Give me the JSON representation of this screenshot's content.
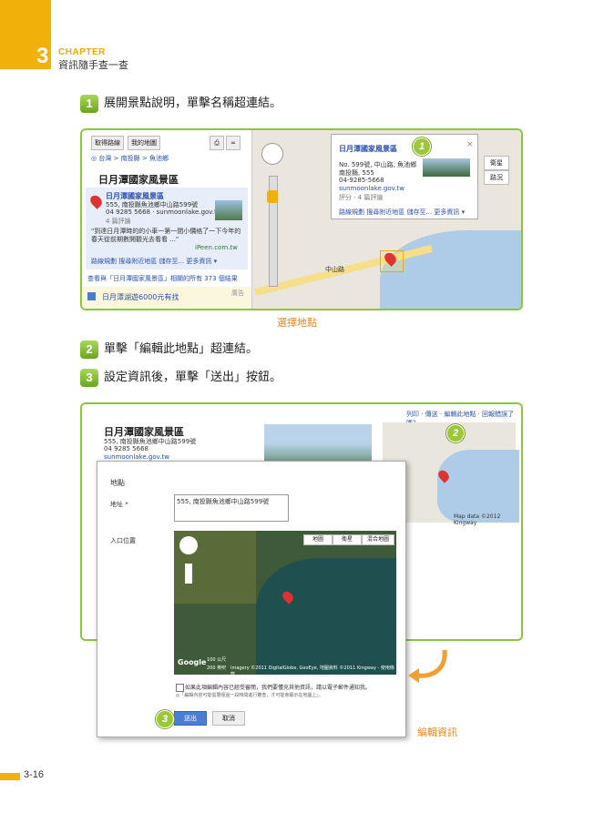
{
  "header": {
    "chapter_label": "CHAPTER",
    "chapter_number": "3",
    "chapter_title": "資訊隨手查一查"
  },
  "steps": [
    {
      "num": "1",
      "text": "展開景點說明，單擊名稱超連結。"
    },
    {
      "num": "2",
      "text": "單擊「編輯此地點」超連結。"
    },
    {
      "num": "3",
      "text": "設定資訊後，單擊「送出」按鈕。"
    }
  ],
  "shot1": {
    "top_buttons": [
      "取得路線",
      "我的地圖"
    ],
    "breadcrumb": "◎ 台灣 > 南投縣 > 魚池鄉",
    "place_title": "日月潭國家風景區",
    "result_title": "日月潭國家風景區",
    "result_address": "555, 南投縣魚池鄉中山路599號",
    "result_phone": "04 9285 5668 · sunmoonlake.gov.tw",
    "result_reviews": "4 篇評論",
    "result_snippet": "\"到達日月潭時的的小車一第一間小價格了一下今年的春天從前期數開觀光去看看 ...\"",
    "result_source": "iPeen.com.tw",
    "result_actions": "路線規劃 搜尋附近地區 儲存至... 更多資訊 ▾",
    "more_results": "查看與「日月潭國家風景區」相關的所有 373 個結果",
    "ad_text": "日月潭湖遊6000元有找",
    "ad_label": "廣告",
    "popup_title": "日月潭國家風景區",
    "popup_address": "No. 599號, 中山路, 魚池鄉",
    "popup_city": "南投縣, 555",
    "popup_phone": "04-9285-5668",
    "popup_url": "sunmoonlake.gov.tw",
    "popup_reviews": "評分 · 4 篇評論",
    "popup_actions": "路線規劃 搜尋附近地區 儲存至... 更多資訊 ▾",
    "map_buttons": [
      "衛星",
      "路況"
    ],
    "road_label": "中山路",
    "callout": "1",
    "caption": "選擇地點"
  },
  "shot2": {
    "top_links": "列印 · 傳送 · 編輯此地點 · 回報錯誤了嗎？",
    "place_title": "日月潭國家風景區",
    "address": "555, 南投縣魚池鄉中山路599號",
    "phone": "04 9285 5668",
    "url": "sunmoonlake.gov.tw",
    "map_credit": "Map data ©2012 Kingway",
    "callout": "2",
    "dialog": {
      "section_label": "地點",
      "address_label": "地址 *",
      "address_value": "555, 南投縣魚池鄉中山路599號",
      "entrance_label": "入口位置",
      "map_types": [
        "地圖",
        "衛星",
        "混合地圖"
      ],
      "scale_label": "100 公尺",
      "scale_label2": "200 英呎",
      "imagery_credit": "Imagery ©2011 DigitalGlobe, GeoEye, 地圖資料 ©2011 Kingway - 使用條款",
      "logo": "Google",
      "checkbox_text": "如果此項編輯內容已經受審閱，我們要懂充其他資訊，請以電子郵件通知我。",
      "note_text": "◎「編輯內容可能需要經過一段時間進行審查，才可能會顯示在地圖上」。",
      "submit": "送出",
      "cancel": "取消",
      "callout": "3"
    },
    "caption": "編輯資訊"
  },
  "footer": {
    "page_number": "3-16"
  },
  "colors": {
    "accent": "#f2b10a",
    "step_green": "#8cc63f",
    "caption_orange": "#e8861a",
    "link_blue": "#2a4fb0"
  }
}
